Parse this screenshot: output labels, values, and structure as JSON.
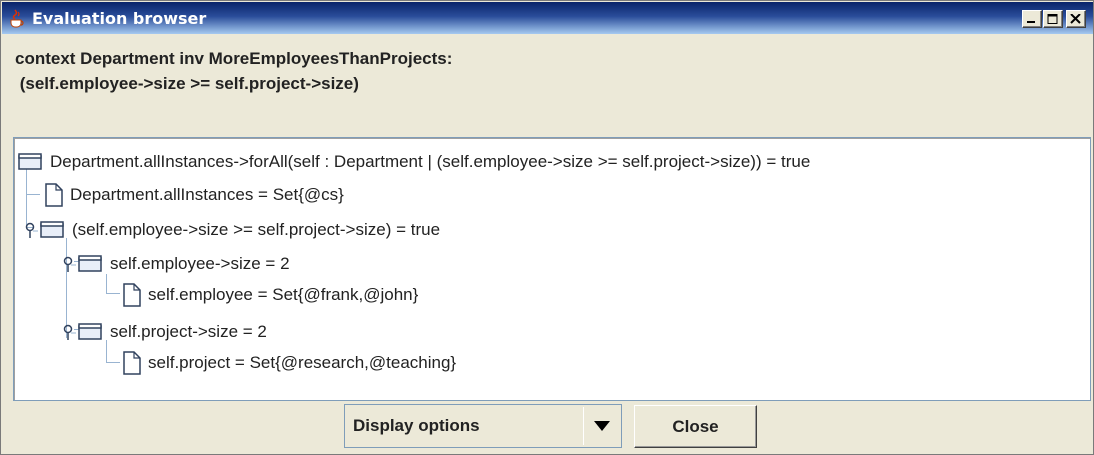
{
  "window": {
    "title": "Evaluation browser",
    "controls": {
      "minimize": "_",
      "maximize": "□",
      "close": "×"
    }
  },
  "context": {
    "line1": "context Department inv MoreEmployeesThanProjects:",
    "line2": " (self.employee->size >= self.project->size)"
  },
  "tree": {
    "nodes": [
      {
        "icon": "folder-icon",
        "label": "Department.allInstances->forAll(self : Department | (self.employee->size >= self.project->size)) = true"
      },
      {
        "icon": "document-icon",
        "label": "Department.allInstances = Set{@cs}"
      },
      {
        "icon": "folder-icon",
        "label": "(self.employee->size >= self.project->size) = true"
      },
      {
        "icon": "folder-icon",
        "label": "self.employee->size = 2"
      },
      {
        "icon": "document-icon",
        "label": "self.employee = Set{@frank,@john}"
      },
      {
        "icon": "folder-icon",
        "label": "self.project->size = 2"
      },
      {
        "icon": "document-icon",
        "label": "self.project = Set{@research,@teaching}"
      }
    ]
  },
  "controls": {
    "display_options": "Display options",
    "close_label": "Close"
  },
  "colors": {
    "titlebar_start": "#0a246a",
    "titlebar_end": "#a6caf0",
    "background": "#ece9d8",
    "tree_guides": "#99b4d1"
  }
}
